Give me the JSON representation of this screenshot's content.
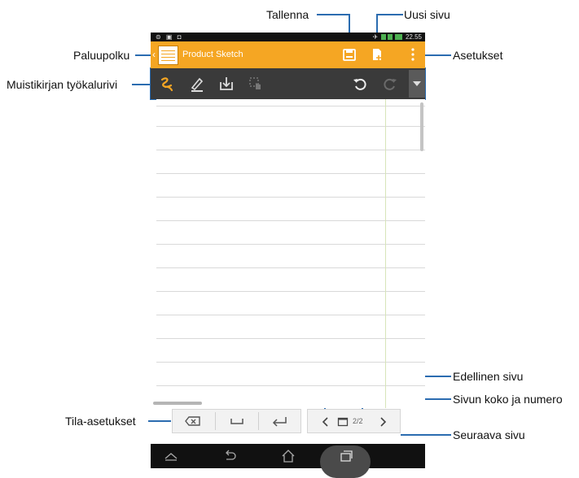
{
  "annotations": {
    "save": "Tallenna",
    "new_page": "Uusi sivu",
    "back_path": "Paluupolku",
    "settings": "Asetukset",
    "toolbar": "Muistikirjan työkalurivi",
    "mode_settings": "Tila-asetukset",
    "previous_page": "Edellinen sivu",
    "page_size_number": "Sivun koko ja numero",
    "next_page": "Seuraava sivu"
  },
  "status_bar": {
    "left_icons": "⊜ ▣ ◘",
    "time": "22.55"
  },
  "action_bar": {
    "title": "Product Sketch",
    "color": "#f5a623"
  },
  "toolbar": {
    "icons": [
      "handwriting-icon",
      "pen-icon",
      "import-icon",
      "gesture-icon",
      "undo-icon",
      "redo-icon",
      "more-icon"
    ],
    "background": "#3a3a3a"
  },
  "page_nav": {
    "page_number": "2/2"
  },
  "accent_color": "#2b6cb0"
}
